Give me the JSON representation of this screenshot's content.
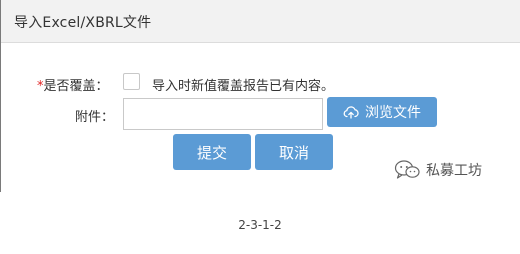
{
  "dialog": {
    "title": "导入Excel/XBRL文件",
    "overwrite": {
      "required_mark": "*",
      "label": "是否覆盖：",
      "checked": false,
      "text": "导入时新值覆盖报告已有内容。"
    },
    "attachment": {
      "label": "附件：",
      "value": "",
      "browse_label": "浏览文件",
      "browse_icon": "cloud-upload-icon"
    },
    "buttons": {
      "submit_label": "提交",
      "cancel_label": "取消"
    },
    "colors": {
      "button_bg": "#5b9bd5",
      "required": "#e02020",
      "header_bg": "#f2f2f2"
    }
  },
  "watermark": {
    "icon": "wechat-icon",
    "text": "私募工坊"
  },
  "caption": "2-3-1-2"
}
